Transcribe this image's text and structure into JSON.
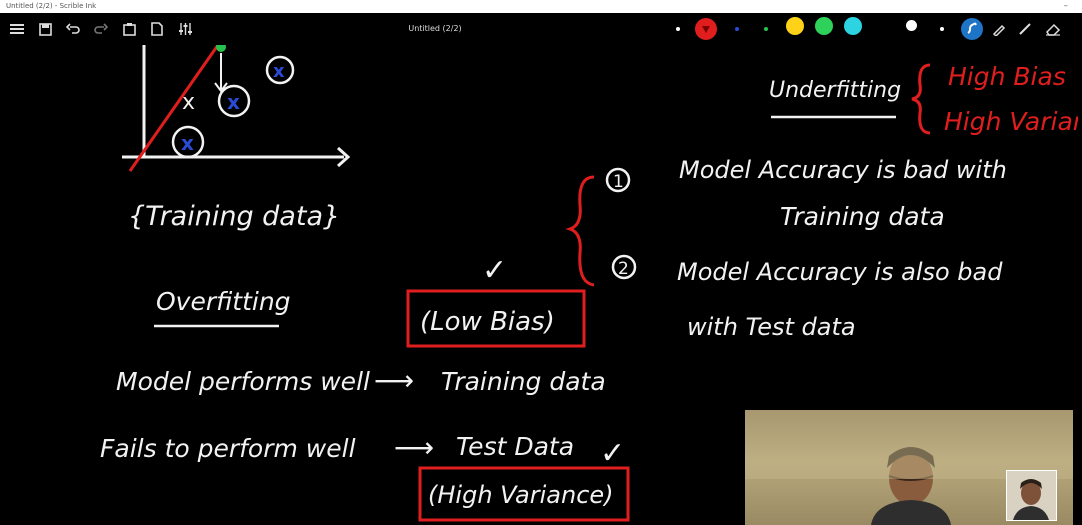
{
  "window": {
    "title": "Untitled (2/2) - Scrible Ink",
    "minimize": "–"
  },
  "toolbar": {
    "doc_title": "Untitled (2/2)",
    "left_icons": [
      "menu-icon",
      "save-icon",
      "undo-icon",
      "redo-icon",
      "clipboard-icon",
      "new-page-icon",
      "settings-sliders-icon"
    ],
    "palette": [
      "#ffffff",
      "#e01e1e",
      "#2b4bd6",
      "#27c24c",
      "#ffd21a",
      "#2ed15a",
      "#2bd4e0",
      "#ffffff"
    ],
    "right_tools": [
      "scribble-pen-icon",
      "highlighter-icon",
      "line-icon",
      "eraser-icon"
    ]
  },
  "canvas": {
    "chart_annotation": {
      "cross": "x",
      "points": [
        "x",
        "x",
        "x"
      ]
    },
    "training_label": "{Training data}",
    "overfitting": "Overfitting",
    "low_bias": "(Low Bias)",
    "model_performs": "Model performs well",
    "arrow1": "⟶",
    "training_data": "Training data",
    "fails": "Fails to perform well",
    "arrow2": "⟶",
    "test_data": "Test Data",
    "high_variance": "(High Variance)",
    "check": "✓",
    "underfitting": "Underfitting",
    "high_bias_red": "High Bias",
    "high_variance_red": "High Variance",
    "num1": "1",
    "line1a": "Model Accuracy is bad with",
    "line1b": "Training data",
    "num2": "2",
    "line2a": "Model Accuracy is also bad",
    "line2b": "with Test data"
  }
}
